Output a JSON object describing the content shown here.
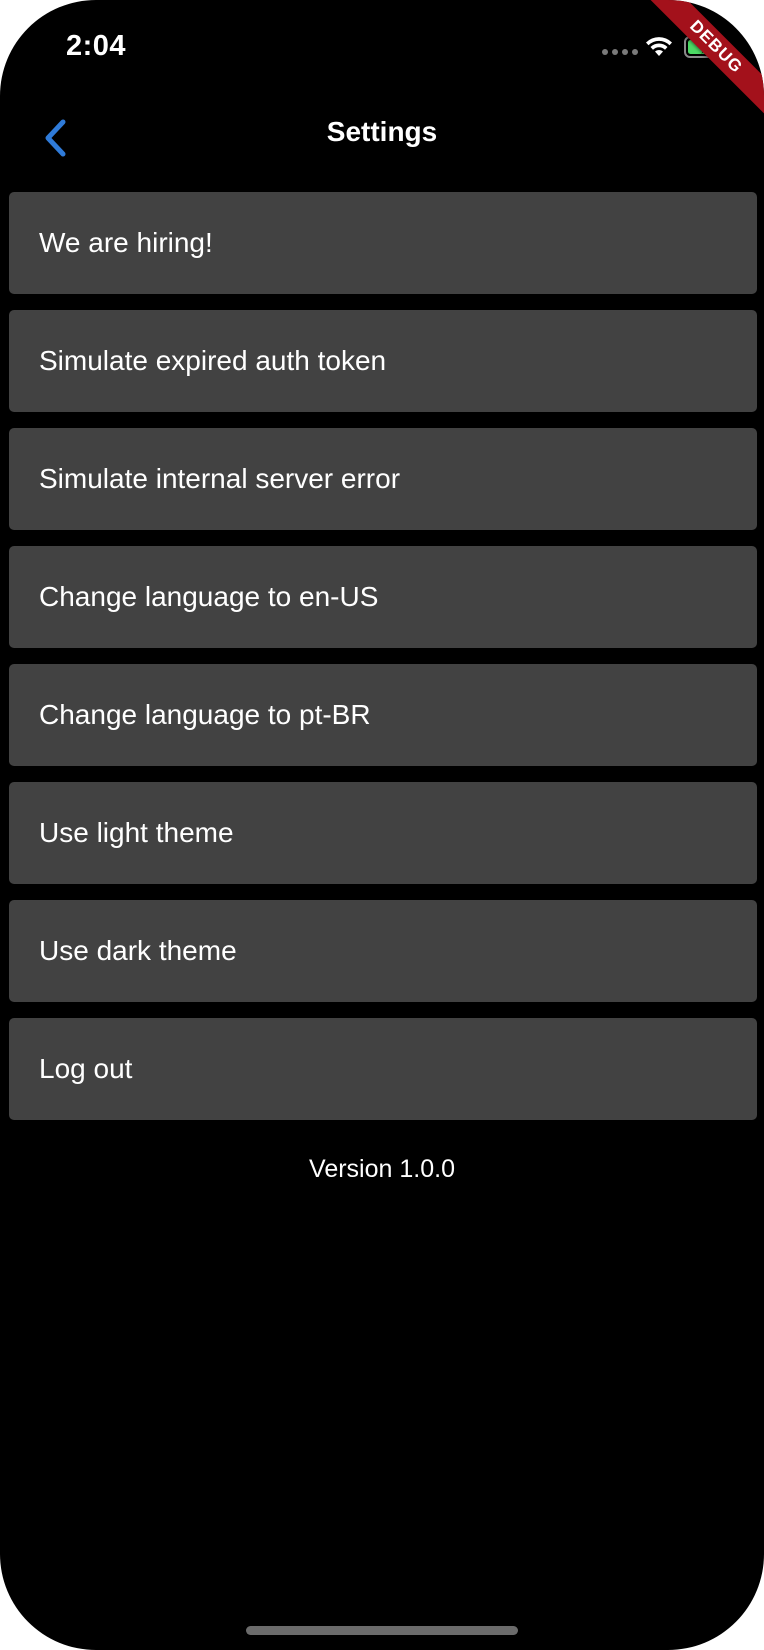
{
  "status_bar": {
    "time": "2:04",
    "debug_label": "DEBUG",
    "wifi_icon": "wifi-icon",
    "battery_icon": "battery-charging-icon",
    "battery_color": "#4cd964"
  },
  "nav": {
    "title": "Settings",
    "back_icon": "chevron-left-icon",
    "accent_color": "#2f7bd9"
  },
  "settings": {
    "items": [
      {
        "label": "We are hiring!"
      },
      {
        "label": "Simulate expired auth token"
      },
      {
        "label": "Simulate internal server error"
      },
      {
        "label": "Change language to en-US"
      },
      {
        "label": "Change language to pt-BR"
      },
      {
        "label": "Use light theme"
      },
      {
        "label": "Use dark theme"
      },
      {
        "label": "Log out"
      }
    ]
  },
  "footer": {
    "version": "Version 1.0.0"
  },
  "colors": {
    "background": "#000000",
    "item_background": "#424242",
    "text": "#ffffff",
    "debug_banner": "#a3111b"
  }
}
